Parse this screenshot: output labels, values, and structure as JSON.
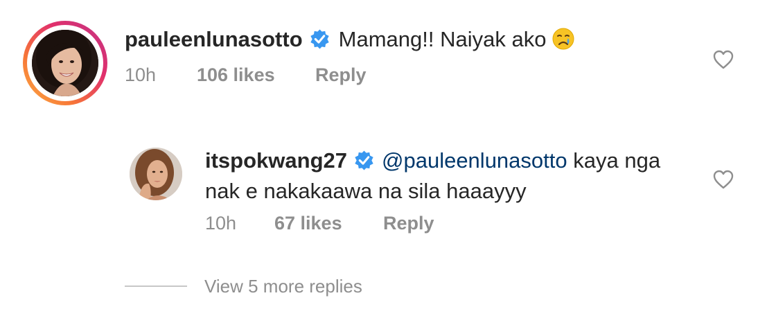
{
  "comments": [
    {
      "username": "pauleenlunasotto",
      "verified": true,
      "text": "Mamang!! Naiyak ako",
      "emoji": "crying-face-emoji",
      "time": "10h",
      "likes": "106 likes",
      "reply_label": "Reply",
      "liked": false
    }
  ],
  "reply": {
    "username": "itspokwang27",
    "verified": true,
    "mention": "@pauleenlunasotto",
    "text": " kaya nga nak e nakakaawa na sila haaayyy",
    "time": "10h",
    "likes": "67 likes",
    "reply_label": "Reply",
    "liked": false
  },
  "view_more_label": "View 5 more replies",
  "icons": {
    "verified": "verified-badge-icon",
    "like": "heart-outline-icon"
  },
  "colors": {
    "verified_blue": "#3897f0",
    "meta_gray": "#8e8e8e",
    "mention_blue": "#00376b",
    "story_ring": [
      "#c13584",
      "#e1306c",
      "#f77737",
      "#fcaf45"
    ]
  }
}
